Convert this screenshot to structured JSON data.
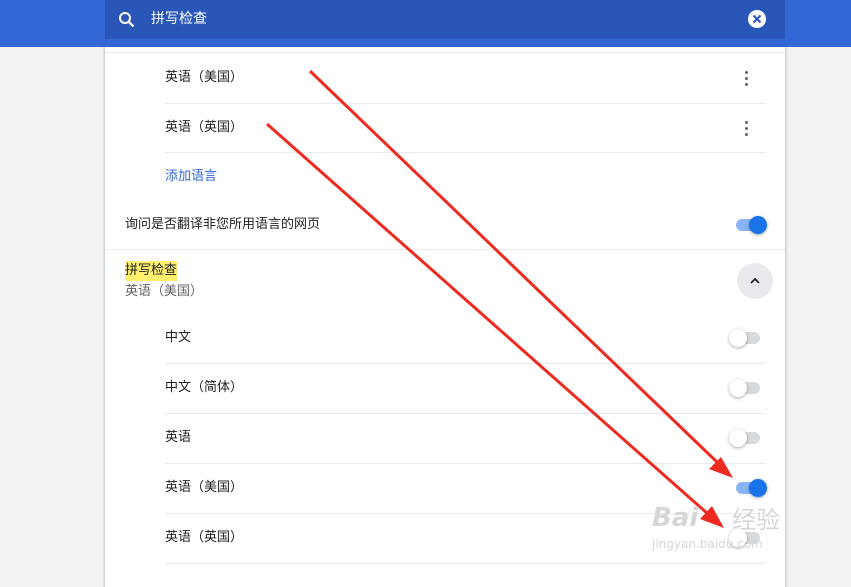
{
  "search": {
    "query": "拼写检查"
  },
  "languages": {
    "items": [
      {
        "label": "英语（美国）"
      },
      {
        "label": "英语（英国）"
      }
    ],
    "add_language": "添加语言"
  },
  "translate_offer": {
    "label": "询问是否翻译非您所用语言的网页",
    "enabled": true
  },
  "spellcheck": {
    "title": "拼写检查",
    "subtitle": "英语（美国）",
    "languages": [
      {
        "label": "中文",
        "enabled": false
      },
      {
        "label": "中文（简体）",
        "enabled": false
      },
      {
        "label": "英语",
        "enabled": false
      },
      {
        "label": "英语（美国）",
        "enabled": true
      },
      {
        "label": "英语（英国）",
        "enabled": false
      }
    ]
  },
  "watermark": {
    "brand": "Bai",
    "brand_cn": "经验",
    "url": "jingyan.baidu.com"
  },
  "colors": {
    "header_blue": "#3367d6",
    "search_bg": "#2a56b8",
    "toggle_on": "#1a73e8",
    "link": "#3367d6",
    "highlight": "#fff16e",
    "annotation_arrow": "#ee2b20"
  }
}
